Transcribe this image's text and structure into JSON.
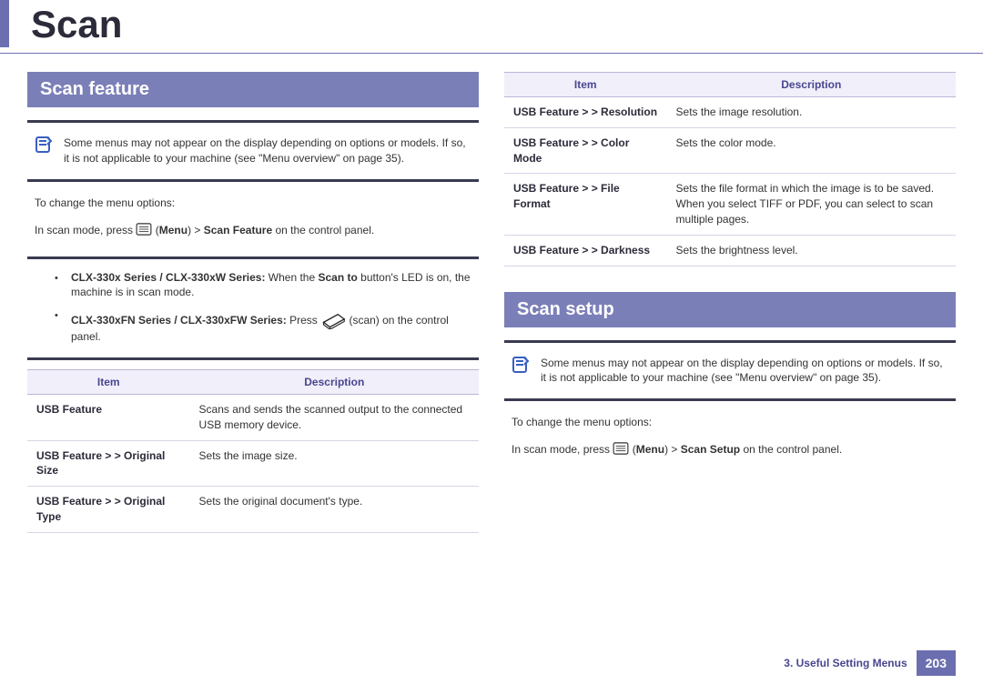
{
  "page_title": "Scan",
  "section_feature": "Scan feature",
  "section_setup": "Scan setup",
  "footer_chapter": "3.  Useful Setting Menus",
  "footer_page": "203",
  "shared_note": "Some menus may not appear on the display depending on options or models. If so, it is not applicable to your machine (see \"Menu overview\" on page 35).",
  "change_options": "To change the menu options:",
  "feature_prompt_pre": "In scan mode, press ",
  "feature_menu_icon_alt": "menu-icon",
  "feature_prompt_mid": "(",
  "feature_menu_bold1": "Menu",
  "feature_menu_arrow": ") > ",
  "feature_menu_bold2": "Scan Feature",
  "feature_prompt_post": " on the control panel.",
  "setup_prompt_pre": "In scan mode, press ",
  "setup_menu_bold1": "Menu",
  "setup_menu_arrow": ") > ",
  "setup_menu_bold2": "Scan Setup",
  "setup_prompt_post": " on the control panel.",
  "bullets": [
    {
      "series_label": "CLX-330x Series / CLX-330xW Series:",
      "series_text_pre": " When the ",
      "series_bold": "Scan to",
      "series_text_post": " button's LED is on, the machine is in scan mode.",
      "show_icon": false
    },
    {
      "series_label": "CLX-330xFN Series / CLX-330xFW Series:",
      "series_text_pre": " Press ",
      "series_bold": "",
      "series_text_post": " (scan) on the control panel.",
      "show_icon": true
    }
  ],
  "table_headers": {
    "item": "Item",
    "desc": "Description"
  },
  "left_rows": [
    {
      "label": "USB Feature",
      "desc": "Scans and sends the scanned output to the connected USB memory device."
    },
    {
      "label": "USB Feature > > Original Size",
      "desc": "Sets the image size."
    },
    {
      "label": "USB Feature > > Original Type",
      "desc": "Sets the original document's type."
    }
  ],
  "right_rows": [
    {
      "label": "USB Feature > > Resolution",
      "desc": "Sets the image resolution."
    },
    {
      "label": "USB Feature > > Color Mode",
      "desc": "Sets the color mode."
    },
    {
      "label": "USB Feature > > File Format",
      "desc": "Sets the file format in which the image is to be saved. When you select TIFF or PDF, you can select to scan multiple pages."
    },
    {
      "label": "USB Feature > > Darkness",
      "desc": "Sets the brightness level."
    }
  ]
}
